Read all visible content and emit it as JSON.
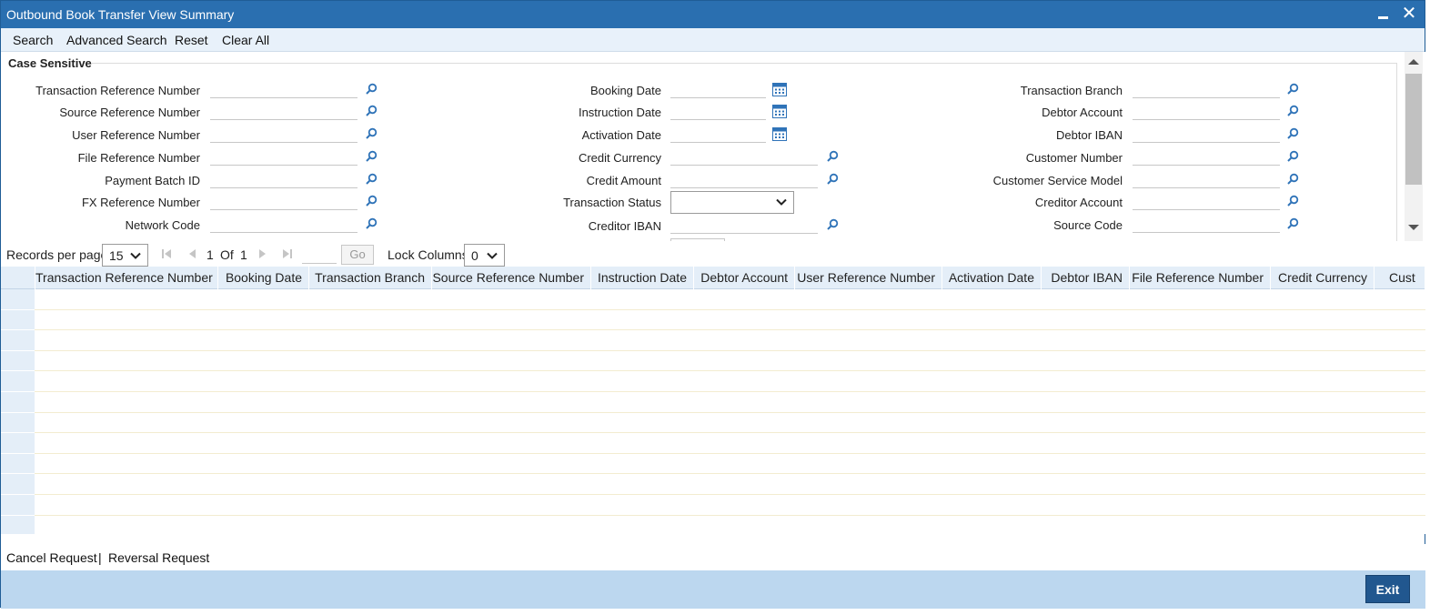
{
  "window": {
    "title": "Outbound Book Transfer View Summary"
  },
  "toolbar": {
    "search": "Search",
    "advanced_search": "Advanced Search",
    "reset": "Reset",
    "clear_all": "Clear All"
  },
  "search_panel": {
    "section_title": "Case Sensitive",
    "col1": [
      {
        "label": "Transaction Reference Number",
        "value": ""
      },
      {
        "label": "Source Reference Number",
        "value": ""
      },
      {
        "label": "User Reference Number",
        "value": ""
      },
      {
        "label": "File Reference Number",
        "value": ""
      },
      {
        "label": "Payment Batch ID",
        "value": ""
      },
      {
        "label": "FX Reference Number",
        "value": ""
      },
      {
        "label": "Network Code",
        "value": ""
      }
    ],
    "col2": [
      {
        "label": "Booking Date",
        "value": ""
      },
      {
        "label": "Instruction Date",
        "value": ""
      },
      {
        "label": "Activation Date",
        "value": ""
      },
      {
        "label": "Credit Currency",
        "value": ""
      },
      {
        "label": "Credit Amount",
        "value": ""
      },
      {
        "label": "Transaction Status",
        "value": ""
      },
      {
        "label": "Creditor IBAN",
        "value": ""
      }
    ],
    "col3": [
      {
        "label": "Transaction Branch",
        "value": ""
      },
      {
        "label": "Debtor Account",
        "value": ""
      },
      {
        "label": "Debtor IBAN",
        "value": ""
      },
      {
        "label": "Customer Number",
        "value": ""
      },
      {
        "label": "Customer Service Model",
        "value": ""
      },
      {
        "label": "Creditor Account",
        "value": ""
      },
      {
        "label": "Source Code",
        "value": ""
      }
    ]
  },
  "pager": {
    "records_per_page_label": "Records per page",
    "records_per_page": "15",
    "current_page": "1",
    "of_label": "Of",
    "total_pages": "1",
    "go_label": "Go",
    "lock_columns_label": "Lock Columns",
    "lock_columns": "0"
  },
  "grid": {
    "columns": [
      "Transaction Reference Number",
      "Booking Date",
      "Transaction Branch",
      "Source Reference Number",
      "Instruction Date",
      "Debtor Account",
      "User Reference Number",
      "Activation Date",
      "Debtor IBAN",
      "File Reference Number",
      "Credit Currency",
      "Cust"
    ],
    "rows": []
  },
  "footer": {
    "cancel_request": "Cancel Request",
    "separator": "|",
    "reversal_request": "Reversal Request"
  },
  "actions": {
    "exit": "Exit"
  },
  "colors": {
    "title_bar": "#2a6fb0",
    "toolbar": "#e8f1fa",
    "grid_header": "#e4eef8",
    "bottom_bar": "#bcd7ef",
    "exit_button": "#21578f",
    "icon_blue": "#2f73b8"
  }
}
